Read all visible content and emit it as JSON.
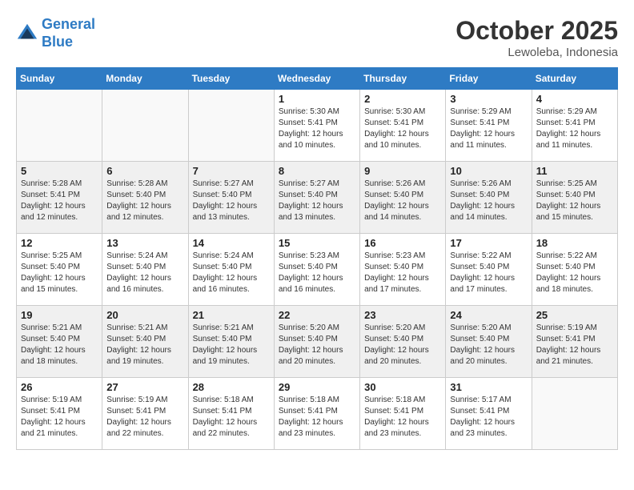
{
  "header": {
    "logo_line1": "General",
    "logo_line2": "Blue",
    "month": "October 2025",
    "location": "Lewoleba, Indonesia"
  },
  "weekdays": [
    "Sunday",
    "Monday",
    "Tuesday",
    "Wednesday",
    "Thursday",
    "Friday",
    "Saturday"
  ],
  "weeks": [
    [
      {
        "day": "",
        "sunrise": "",
        "sunset": "",
        "daylight": ""
      },
      {
        "day": "",
        "sunrise": "",
        "sunset": "",
        "daylight": ""
      },
      {
        "day": "",
        "sunrise": "",
        "sunset": "",
        "daylight": ""
      },
      {
        "day": "1",
        "sunrise": "Sunrise: 5:30 AM",
        "sunset": "Sunset: 5:41 PM",
        "daylight": "Daylight: 12 hours and 10 minutes."
      },
      {
        "day": "2",
        "sunrise": "Sunrise: 5:30 AM",
        "sunset": "Sunset: 5:41 PM",
        "daylight": "Daylight: 12 hours and 10 minutes."
      },
      {
        "day": "3",
        "sunrise": "Sunrise: 5:29 AM",
        "sunset": "Sunset: 5:41 PM",
        "daylight": "Daylight: 12 hours and 11 minutes."
      },
      {
        "day": "4",
        "sunrise": "Sunrise: 5:29 AM",
        "sunset": "Sunset: 5:41 PM",
        "daylight": "Daylight: 12 hours and 11 minutes."
      }
    ],
    [
      {
        "day": "5",
        "sunrise": "Sunrise: 5:28 AM",
        "sunset": "Sunset: 5:41 PM",
        "daylight": "Daylight: 12 hours and 12 minutes."
      },
      {
        "day": "6",
        "sunrise": "Sunrise: 5:28 AM",
        "sunset": "Sunset: 5:40 PM",
        "daylight": "Daylight: 12 hours and 12 minutes."
      },
      {
        "day": "7",
        "sunrise": "Sunrise: 5:27 AM",
        "sunset": "Sunset: 5:40 PM",
        "daylight": "Daylight: 12 hours and 13 minutes."
      },
      {
        "day": "8",
        "sunrise": "Sunrise: 5:27 AM",
        "sunset": "Sunset: 5:40 PM",
        "daylight": "Daylight: 12 hours and 13 minutes."
      },
      {
        "day": "9",
        "sunrise": "Sunrise: 5:26 AM",
        "sunset": "Sunset: 5:40 PM",
        "daylight": "Daylight: 12 hours and 14 minutes."
      },
      {
        "day": "10",
        "sunrise": "Sunrise: 5:26 AM",
        "sunset": "Sunset: 5:40 PM",
        "daylight": "Daylight: 12 hours and 14 minutes."
      },
      {
        "day": "11",
        "sunrise": "Sunrise: 5:25 AM",
        "sunset": "Sunset: 5:40 PM",
        "daylight": "Daylight: 12 hours and 15 minutes."
      }
    ],
    [
      {
        "day": "12",
        "sunrise": "Sunrise: 5:25 AM",
        "sunset": "Sunset: 5:40 PM",
        "daylight": "Daylight: 12 hours and 15 minutes."
      },
      {
        "day": "13",
        "sunrise": "Sunrise: 5:24 AM",
        "sunset": "Sunset: 5:40 PM",
        "daylight": "Daylight: 12 hours and 16 minutes."
      },
      {
        "day": "14",
        "sunrise": "Sunrise: 5:24 AM",
        "sunset": "Sunset: 5:40 PM",
        "daylight": "Daylight: 12 hours and 16 minutes."
      },
      {
        "day": "15",
        "sunrise": "Sunrise: 5:23 AM",
        "sunset": "Sunset: 5:40 PM",
        "daylight": "Daylight: 12 hours and 16 minutes."
      },
      {
        "day": "16",
        "sunrise": "Sunrise: 5:23 AM",
        "sunset": "Sunset: 5:40 PM",
        "daylight": "Daylight: 12 hours and 17 minutes."
      },
      {
        "day": "17",
        "sunrise": "Sunrise: 5:22 AM",
        "sunset": "Sunset: 5:40 PM",
        "daylight": "Daylight: 12 hours and 17 minutes."
      },
      {
        "day": "18",
        "sunrise": "Sunrise: 5:22 AM",
        "sunset": "Sunset: 5:40 PM",
        "daylight": "Daylight: 12 hours and 18 minutes."
      }
    ],
    [
      {
        "day": "19",
        "sunrise": "Sunrise: 5:21 AM",
        "sunset": "Sunset: 5:40 PM",
        "daylight": "Daylight: 12 hours and 18 minutes."
      },
      {
        "day": "20",
        "sunrise": "Sunrise: 5:21 AM",
        "sunset": "Sunset: 5:40 PM",
        "daylight": "Daylight: 12 hours and 19 minutes."
      },
      {
        "day": "21",
        "sunrise": "Sunrise: 5:21 AM",
        "sunset": "Sunset: 5:40 PM",
        "daylight": "Daylight: 12 hours and 19 minutes."
      },
      {
        "day": "22",
        "sunrise": "Sunrise: 5:20 AM",
        "sunset": "Sunset: 5:40 PM",
        "daylight": "Daylight: 12 hours and 20 minutes."
      },
      {
        "day": "23",
        "sunrise": "Sunrise: 5:20 AM",
        "sunset": "Sunset: 5:40 PM",
        "daylight": "Daylight: 12 hours and 20 minutes."
      },
      {
        "day": "24",
        "sunrise": "Sunrise: 5:20 AM",
        "sunset": "Sunset: 5:40 PM",
        "daylight": "Daylight: 12 hours and 20 minutes."
      },
      {
        "day": "25",
        "sunrise": "Sunrise: 5:19 AM",
        "sunset": "Sunset: 5:41 PM",
        "daylight": "Daylight: 12 hours and 21 minutes."
      }
    ],
    [
      {
        "day": "26",
        "sunrise": "Sunrise: 5:19 AM",
        "sunset": "Sunset: 5:41 PM",
        "daylight": "Daylight: 12 hours and 21 minutes."
      },
      {
        "day": "27",
        "sunrise": "Sunrise: 5:19 AM",
        "sunset": "Sunset: 5:41 PM",
        "daylight": "Daylight: 12 hours and 22 minutes."
      },
      {
        "day": "28",
        "sunrise": "Sunrise: 5:18 AM",
        "sunset": "Sunset: 5:41 PM",
        "daylight": "Daylight: 12 hours and 22 minutes."
      },
      {
        "day": "29",
        "sunrise": "Sunrise: 5:18 AM",
        "sunset": "Sunset: 5:41 PM",
        "daylight": "Daylight: 12 hours and 23 minutes."
      },
      {
        "day": "30",
        "sunrise": "Sunrise: 5:18 AM",
        "sunset": "Sunset: 5:41 PM",
        "daylight": "Daylight: 12 hours and 23 minutes."
      },
      {
        "day": "31",
        "sunrise": "Sunrise: 5:17 AM",
        "sunset": "Sunset: 5:41 PM",
        "daylight": "Daylight: 12 hours and 23 minutes."
      },
      {
        "day": "",
        "sunrise": "",
        "sunset": "",
        "daylight": ""
      }
    ]
  ]
}
